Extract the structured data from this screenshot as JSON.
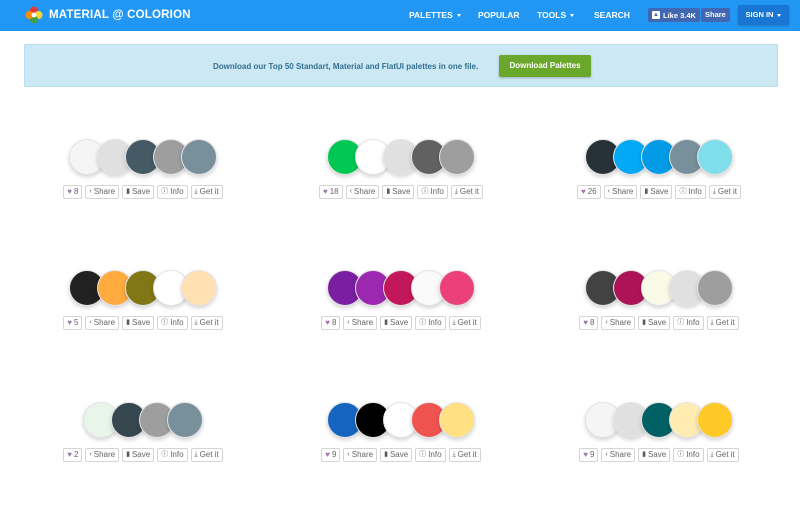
{
  "header": {
    "brand": "MATERIAL @ COLORION",
    "nav": [
      {
        "label": "PALETTES",
        "dropdown": true
      },
      {
        "label": "POPULAR",
        "dropdown": false
      },
      {
        "label": "TOOLS",
        "dropdown": true
      },
      {
        "label": "SEARCH",
        "dropdown": false
      }
    ],
    "fb_like": "Like 3.4K",
    "fb_share": "Share",
    "signin": "SIGN IN"
  },
  "banner": {
    "text": "Download our Top 50 Standart, Material and FlatUI palettes in one file.",
    "button": "Download Palettes"
  },
  "action_labels": {
    "share": "Share",
    "save": "Save",
    "info": "Info",
    "get": "Get it"
  },
  "palettes": [
    {
      "likes": "8",
      "colors": [
        "#f5f5f5",
        "#e0e0e0",
        "#455a64",
        "#9e9e9e",
        "#78909c"
      ]
    },
    {
      "likes": "18",
      "colors": [
        "#00c853",
        "#ffffff",
        "#e0e0e0",
        "#616161",
        "#9e9e9e"
      ]
    },
    {
      "likes": "26",
      "colors": [
        "#263238",
        "#03a9f4",
        "#039be5",
        "#78909c",
        "#80deea"
      ]
    },
    {
      "likes": "5",
      "colors": [
        "#212121",
        "#ffab40",
        "#827717",
        "#ffffff",
        "#ffe0b2"
      ]
    },
    {
      "likes": "8",
      "colors": [
        "#7b1fa2",
        "#9c27b0",
        "#c2185b",
        "#fafafa",
        "#ec407a"
      ]
    },
    {
      "likes": "8",
      "colors": [
        "#424242",
        "#ad1457",
        "#f9fbe7",
        "#e0e0e0",
        "#9e9e9e"
      ]
    },
    {
      "likes": "2",
      "colors": [
        "#e8f5e9",
        "#37474f",
        "#9e9e9e",
        "#78909c"
      ]
    },
    {
      "likes": "9",
      "colors": [
        "#1565c0",
        "#000000",
        "#ffffff",
        "#ef5350",
        "#ffe082"
      ]
    },
    {
      "likes": "9",
      "colors": [
        "#f5f5f5",
        "#e0e0e0",
        "#006064",
        "#ffecb3",
        "#ffca28"
      ]
    }
  ]
}
